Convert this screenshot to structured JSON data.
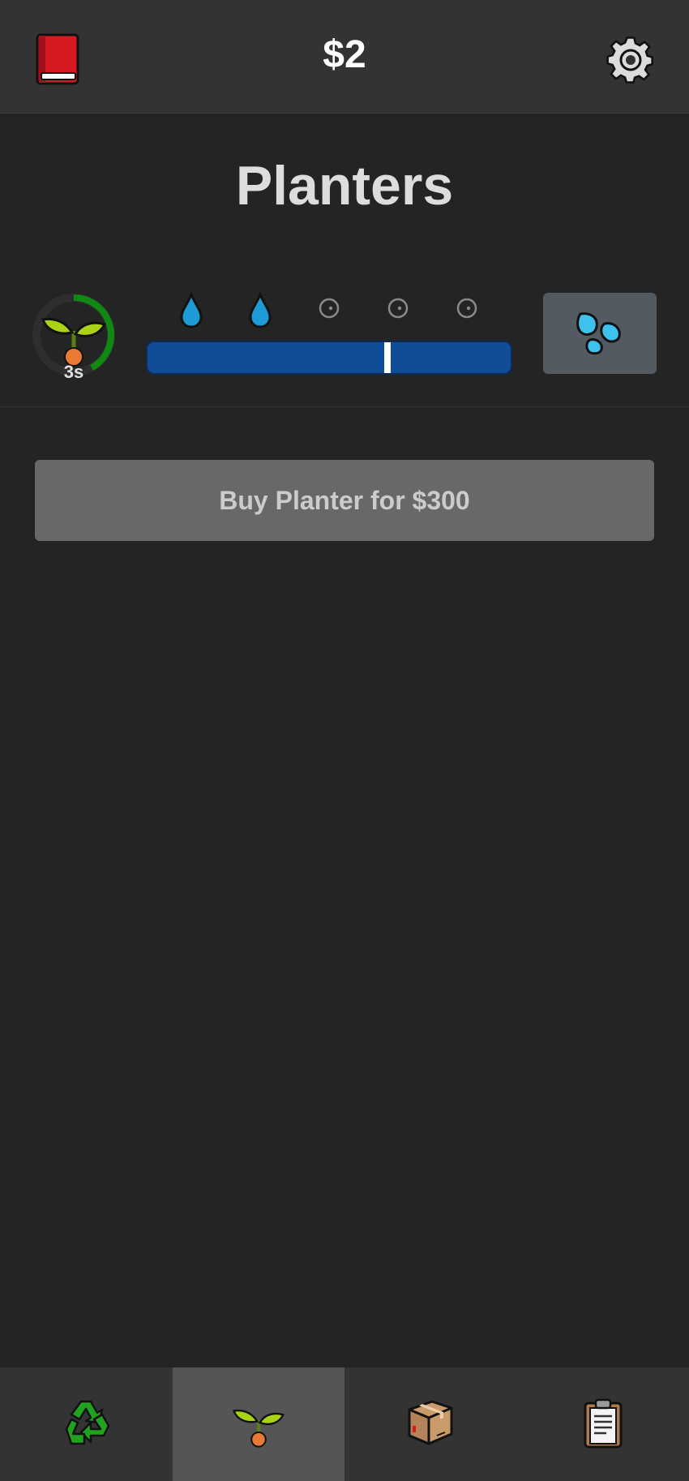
{
  "header": {
    "money": "$2",
    "book_icon": "red-book-icon",
    "settings_icon": "gear-icon"
  },
  "page": {
    "title": "Planters"
  },
  "planter": {
    "timer_label": "3s",
    "timer_progress": 0.42,
    "plant_icon": "seedling-icon",
    "water_drops": [
      "filled",
      "filled",
      "empty",
      "empty",
      "empty"
    ],
    "water_level": 0.66,
    "water_button_icon": "sweat-droplets-icon"
  },
  "actions": {
    "buy_label": "Buy Planter for $300"
  },
  "nav": {
    "tabs": [
      {
        "icon": "recycle-icon",
        "active": false
      },
      {
        "icon": "seedling-icon",
        "active": true
      },
      {
        "icon": "package-icon",
        "active": false
      },
      {
        "icon": "clipboard-icon",
        "active": false
      }
    ]
  },
  "colors": {
    "background": "#242424",
    "bar": "#333333",
    "water": "#114d96",
    "timer_ring": "#118811",
    "drop": "#1d9bd6"
  }
}
